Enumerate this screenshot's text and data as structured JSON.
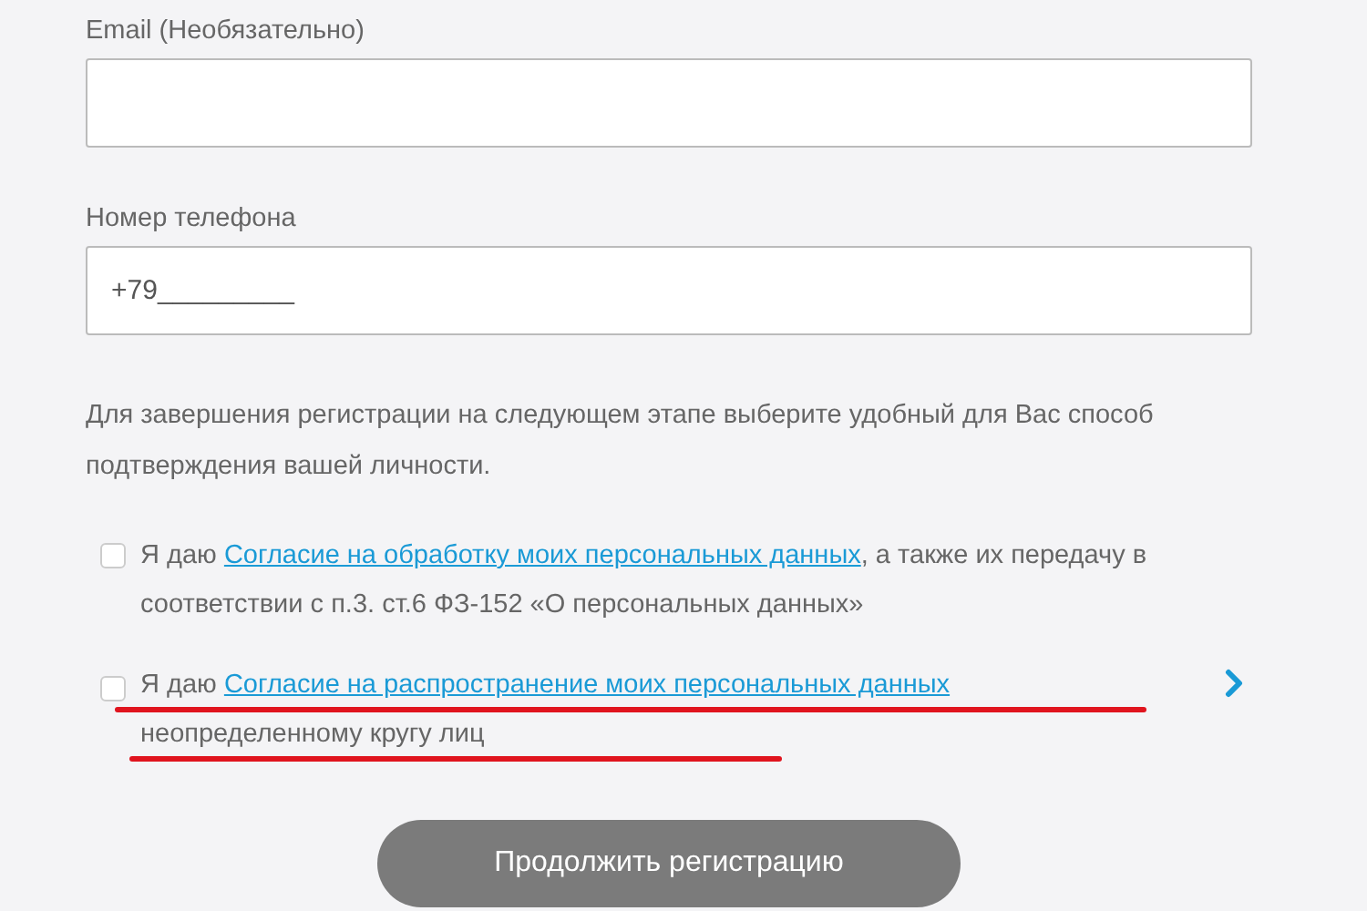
{
  "fields": [
    {
      "label": "Email (Необязательно)"
    },
    {
      "label": "Номер телефона",
      "value": "+79_________"
    }
  ],
  "note": "Для завершения регистрации на следующем этапе выберите удобный для Вас способ подтверждения вашей личности.",
  "consents": [
    {
      "checked": false,
      "prefix": "Я даю",
      "link": "Согласие на обработку моих персональных данных",
      "suffix": ", а также их передачу в соответствии с п.3. ст.6 ФЗ-152 «О персональных данных»",
      "underlined": false
    },
    {
      "checked": false,
      "prefix": "Я даю",
      "link": "Согласие на распространение моих персональных данных",
      "suffix": "неопределенному кругу лиц",
      "underlined": true
    }
  ],
  "submit": "Продолжить регистрацию"
}
